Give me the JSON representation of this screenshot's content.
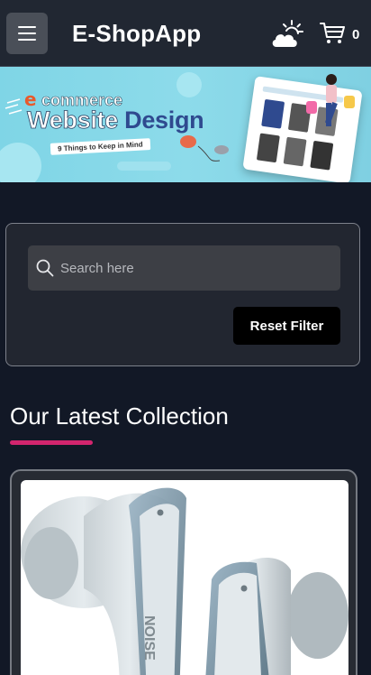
{
  "header": {
    "brand": "E-ShopApp",
    "menu_icon": "hamburger-menu-icon",
    "weather_icon": "partly-cloudy-icon",
    "cart_icon": "shopping-cart-icon",
    "cart_count": "0"
  },
  "banner": {
    "line1_e": "e",
    "line1_rest": "commerce",
    "title_a": "Website ",
    "title_b": "Design",
    "subtitle": "9 Things to Keep in Mind",
    "colors": {
      "accent": "#e85a2c",
      "title_dark": "#2f4a8f",
      "bg": "#8ddbea"
    }
  },
  "filter": {
    "search_placeholder": "Search here",
    "search_value": "",
    "reset_label": "Reset Filter"
  },
  "collection": {
    "title": "Our Latest Collection",
    "accent_color": "#d3256e",
    "products": [
      {
        "image_desc": "noise earbuds",
        "brand_text": "NOISE"
      }
    ]
  }
}
